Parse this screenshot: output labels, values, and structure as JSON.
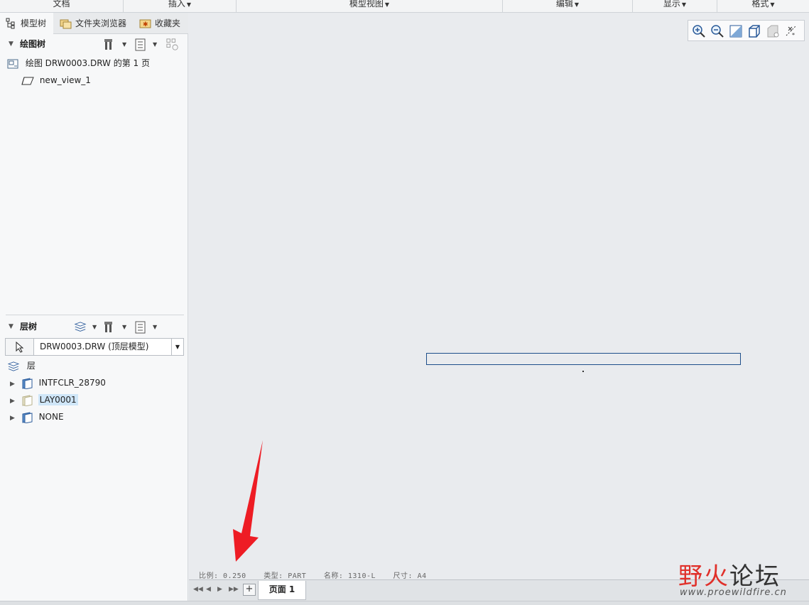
{
  "ribbon": {
    "groups": [
      {
        "label": "文档",
        "caret": false
      },
      {
        "label": "插入",
        "caret": true
      },
      {
        "label": "模型视图",
        "caret": true
      },
      {
        "label": "编辑",
        "caret": true
      },
      {
        "label": "显示",
        "caret": true
      },
      {
        "label": "格式",
        "caret": true
      }
    ]
  },
  "left_panel": {
    "tabs": [
      {
        "label": "模型树",
        "icon": "model-tree-icon",
        "active": true
      },
      {
        "label": "文件夹浏览器",
        "icon": "folder-browser-icon",
        "active": false
      },
      {
        "label": "收藏夹",
        "icon": "favorites-icon",
        "active": false
      }
    ],
    "drawing_tree": {
      "title": "绘图树",
      "items": [
        {
          "label": "绘图 DRW0003.DRW 的第 1 页",
          "icon": "drawing-sheet-icon"
        },
        {
          "label": "new_view_1",
          "icon": "view-icon"
        }
      ]
    },
    "layer_tree": {
      "title": "层树",
      "model_select": "DRW0003.DRW (顶层模型)",
      "root_label": "层",
      "items": [
        {
          "label": "INTFCLR_28790",
          "selected": false,
          "icon": "layer-icon"
        },
        {
          "label": "LAY0001",
          "selected": true,
          "icon": "layer-hidden-icon"
        },
        {
          "label": "NONE",
          "selected": false,
          "icon": "layer-icon"
        }
      ]
    }
  },
  "graphics": {
    "status_line": [
      "比例: 0.250",
      "类型: PART",
      "名称: 1310-L",
      "尺寸: A4"
    ]
  },
  "sheet_bar": {
    "add_label": "+",
    "page_tab": "页面 1"
  },
  "watermark": {
    "title_part1": "野火",
    "title_part2": "论坛",
    "url": "www.proewildfire.cn"
  },
  "colors": {
    "accent_red": "#e0302a",
    "selection": "#cfe6f8",
    "frame_blue": "#1d4e8a"
  }
}
